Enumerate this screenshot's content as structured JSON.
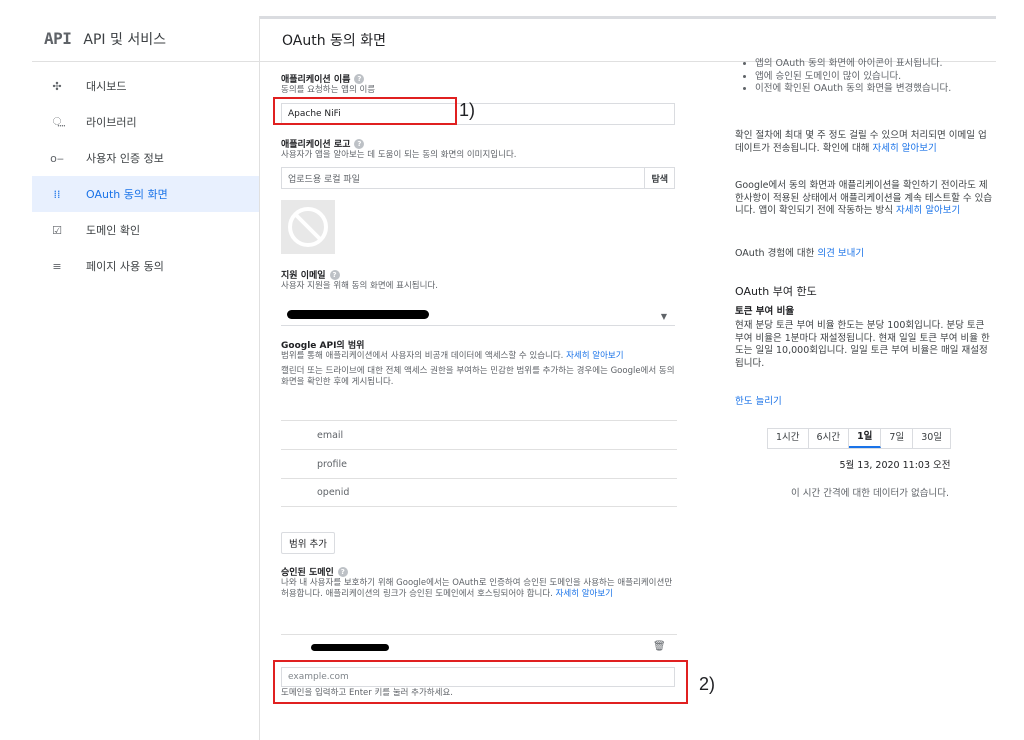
{
  "nav": {
    "logo": "API",
    "title": "API 및 서비스",
    "items": [
      {
        "label": "대시보드",
        "icon": "dashboard-icon",
        "glyph": "✣"
      },
      {
        "label": "라이브러리",
        "icon": "library-icon",
        "glyph": "⵿"
      },
      {
        "label": "사용자 인증 정보",
        "icon": "key-icon",
        "glyph": "o‒"
      },
      {
        "label": "OAuth 동의 화면",
        "icon": "oauth-icon",
        "glyph": "⁞⁞"
      },
      {
        "label": "도메인 확인",
        "icon": "domain-check-icon",
        "glyph": "☑"
      },
      {
        "label": "페이지 사용 동의",
        "icon": "settings-list-icon",
        "glyph": "≡"
      }
    ],
    "active_index": 3
  },
  "page": {
    "title": "OAuth 동의 화면"
  },
  "form": {
    "app_name": {
      "label": "애플리케이션 이름",
      "desc": "동의를 요청하는 앱의 이름",
      "value": "Apache NiFi",
      "annotation": "1)"
    },
    "app_logo": {
      "label": "애플리케이션 로고",
      "desc": "사용자가 앱을 알아보는 데 도움이 되는 동의 화면의 이미지입니다.",
      "placeholder": "업로드용 로컬 파일",
      "button": "탐색"
    },
    "support_email": {
      "label": "지원 이메일",
      "desc": "사용자 지원을 위해 동의 화면에 표시됩니다."
    },
    "scopes": {
      "label": "Google API의 범위",
      "desc": "범위를 통해 애플리케이션에서 사용자의 비공개 데이터에 액세스할 수 있습니다.",
      "desc_link": "자세히 알아보기",
      "desc2": "캘린더 또는 드라이브에 대한 전체 액세스 권한을 부여하는 민감한 범위를 추가하는 경우에는 Google에서 동의 화면을 확인한 후에 게시됩니다.",
      "items": [
        "email",
        "profile",
        "openid"
      ],
      "add_button": "범위 추가"
    },
    "domains": {
      "label": "승인된 도메인",
      "desc": "나와 내 사용자를 보호하기 위해 Google에서는 OAuth로 인증하여 승인된 도메인을 사용하는 애플리케이션만 허용합니다. 애플리케이션의 링크가 승인된 도메인에서 호스팅되어야 합니다.",
      "desc_link": "자세히 알아보기",
      "placeholder": "example.com",
      "hint": "도메인을 입력하고 Enter 키를 눌러 추가하세요.",
      "annotation": "2)"
    }
  },
  "right": {
    "bullets": [
      "앱의 OAuth 동의 화면에 아이콘이 표시됩니다.",
      "앱에 승인된 도메인이 많이 있습니다.",
      "이전에 확인된 OAuth 동의 화면을 변경했습니다."
    ],
    "p1": "확인 절차에 최대 몇 주 정도 걸릴 수 있으며 처리되면 이메일 업데이트가 전송됩니다. 확인에 대해",
    "p1_link": "자세히 알아보기",
    "p2": "Google에서 동의 화면과 애플리케이션을 확인하기 전이라도 제한사항이 적용된 상태에서 애플리케이션을 계속 테스트할 수 있습니다. 앱이 확인되기 전에 작동하는 방식",
    "p2_link": "자세히 알아보기",
    "feedback": "OAuth 경험에 대한",
    "feedback_link": "의견 보내기",
    "grant_title": "OAuth 부여 한도",
    "token_sub": "토큰 부여 비율",
    "token_desc": "현재 분당 토큰 부여 비율 한도는 분당 100회입니다. 분당 토큰 부여 비율은 1분마다 재설정됩니다. 현재 일일 토큰 부여 비율 한도는 일일 10,000회입니다. 일일 토큰 부여 비율은 매일 재설정됩니다.",
    "raise_link": "한도 늘리기",
    "ranges": [
      "1시간",
      "6시간",
      "1일",
      "7일",
      "30일"
    ],
    "active_range": "1일",
    "timestamp": "5월 13, 2020 11:03 오전",
    "nodata": "이 시간 간격에 대한 데이터가 없습니다."
  }
}
